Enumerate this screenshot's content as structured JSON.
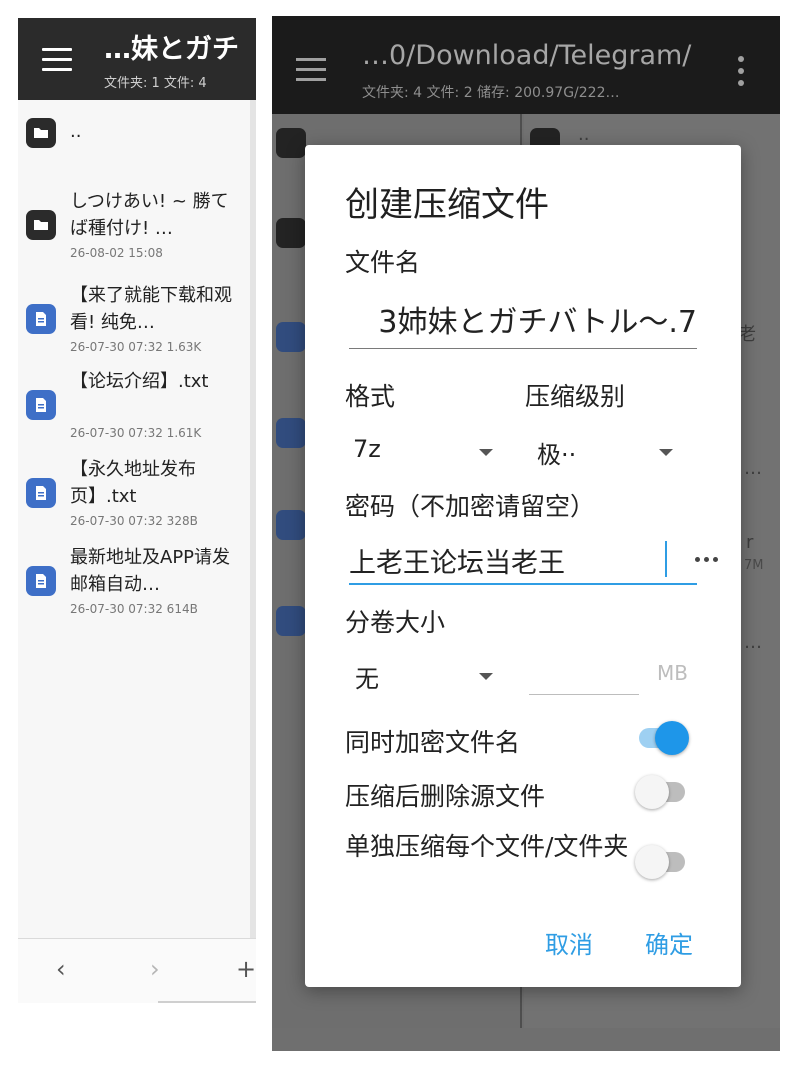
{
  "left_pane": {
    "title": "…妹とガチ",
    "subtitle": "文件夹: 1  文件: 4",
    "items": [
      {
        "name": "..",
        "meta": "",
        "icon": "folder-icon"
      },
      {
        "name": "しつけあい! ~ 勝てば種付け! …",
        "meta": "26-08-02 15:08",
        "icon": "folder-icon"
      },
      {
        "name": "【来了就能下载和观看! 纯免…",
        "meta": "26-07-30 07:32  1.63K",
        "icon": "file-icon"
      },
      {
        "name": "【论坛介绍】.txt",
        "meta": "26-07-30 07:32  1.61K",
        "icon": "file-icon"
      },
      {
        "name": "【永久地址发布页】.txt",
        "meta": "26-07-30 07:32  328B",
        "icon": "file-icon"
      },
      {
        "name": "最新地址及APP请发邮箱自动…",
        "meta": "26-07-30 07:32  614B",
        "icon": "file-icon"
      }
    ],
    "nav": {
      "back": "‹",
      "forward": "›",
      "add": "+"
    }
  },
  "right_pane": {
    "title": "…0/Download/Telegram/",
    "subtitle": "文件夹: 4  文件: 2  储存: 200.97G/222…",
    "bg_labels": {
      "dotdot": "..",
      "r1": "老",
      "r2": "…",
      "r3": "r",
      "r3_meta": "7M",
      "r4": "…"
    }
  },
  "dialog": {
    "title": "创建压缩文件",
    "filename_label": "文件名",
    "filename_value": "3姉妹とガチバトル～.7",
    "format_label": "格式",
    "format_value": "7z",
    "level_label": "压缩级别",
    "level_value": "极··",
    "password_label": "密码（不加密请留空）",
    "password_value": "上老王论坛当老王",
    "split_label": "分卷大小",
    "split_value": "无",
    "split_unit": "MB",
    "encrypt_names_label": "同时加密文件名",
    "encrypt_names_on": true,
    "delete_source_label": "压缩后删除源文件",
    "delete_source_on": false,
    "separate_label": "单独压缩每个文件/文件夹",
    "separate_on": false,
    "cancel_label": "取消",
    "ok_label": "确定"
  },
  "colors": {
    "accent": "#1e96e9",
    "accent_light": "#9ed0f2",
    "header_dark": "#2b2b2b",
    "file_icon": "#3e6fc7"
  }
}
